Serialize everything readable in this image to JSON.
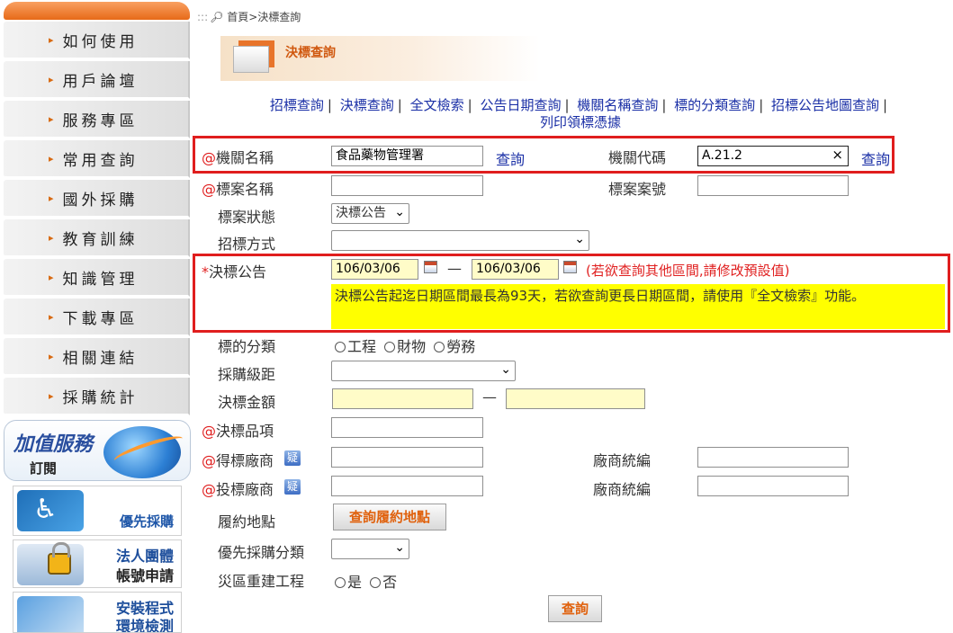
{
  "sidebar": {
    "items": [
      "如何使用",
      "用戶論壇",
      "服務專區",
      "常用查詢",
      "國外採購",
      "教育訓練",
      "知識管理",
      "下載專區",
      "相關連結",
      "採購統計"
    ],
    "banners": {
      "value_service_title": "加值服務",
      "value_service_sub": "訂閱",
      "priority_label": "優先採購",
      "legal_line1": "法人團體",
      "legal_line2": "帳號申請",
      "install_line1": "安裝程式",
      "install_line2": "環境檢測"
    }
  },
  "breadcrumb": {
    "prefix": ":::",
    "path": "首頁>決標查詢"
  },
  "page_title": "決標查詢",
  "quicklinks": [
    "招標查詢",
    "決標查詢",
    "全文檢索",
    "公告日期查詢",
    "機關名稱查詢",
    "標的分類查詢",
    "招標公告地圖查詢",
    "列印領標憑據"
  ],
  "form": {
    "agency_name": {
      "marker": "@",
      "label": "機關名稱",
      "value": "食品藥物管理署",
      "link": "查詢"
    },
    "agency_code": {
      "label": "機關代碼",
      "value": "A.21.2",
      "clear": "×",
      "link": "查詢"
    },
    "case_name": {
      "marker": "@",
      "label": "標案名稱",
      "value": ""
    },
    "case_number": {
      "label": "標案案號",
      "value": ""
    },
    "case_status": {
      "label": "標案狀態",
      "value": "決標公告"
    },
    "tender_method": {
      "label": "招標方式",
      "value": ""
    },
    "award_notice": {
      "marker": "*",
      "label": "決標公告",
      "date_from": "106/03/06",
      "dash": "—",
      "date_to": "106/03/06",
      "hint": "(若欲查詢其他區間,請修改預設值)",
      "warning": "決標公告起迄日期區間最長為93天，若欲查詢更長日期區間，請使用『全文檢索』功能。"
    },
    "subject_category": {
      "label": "標的分類",
      "options": [
        "工程",
        "財物",
        "勞務"
      ]
    },
    "procurement_level": {
      "label": "採購級距",
      "value": ""
    },
    "award_amount": {
      "label": "決標金額",
      "dash": "—",
      "from": "",
      "to": ""
    },
    "award_item": {
      "marker": "@",
      "label": "決標品項",
      "value": ""
    },
    "winning_vendor": {
      "marker": "@",
      "label": "得標廠商",
      "tax_label": "廠商統編",
      "badge": "疑"
    },
    "bidding_vendor": {
      "marker": "@",
      "label": "投標廠商",
      "tax_label": "廠商統編",
      "badge": "疑"
    },
    "performance_location": {
      "label": "履約地點",
      "button": "查詢履約地點"
    },
    "priority_category": {
      "label": "優先採購分類",
      "value": ""
    },
    "disaster_project": {
      "label": "災區重建工程",
      "options": [
        "是",
        "否"
      ]
    },
    "submit": "查詢"
  },
  "colors": {
    "accent": "#e0620e",
    "link": "#1a2fa6",
    "required": "#e02020",
    "highlight_box": "#e01e1e",
    "warning_bg": "#ffff00"
  }
}
